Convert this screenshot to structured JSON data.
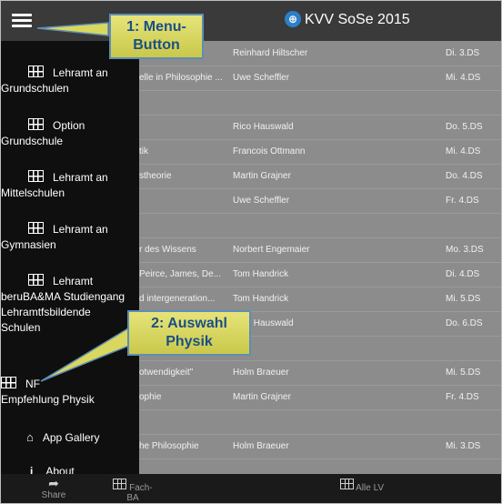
{
  "header": {
    "title": "KVV SoSe 2015"
  },
  "list_rows": [
    {
      "c1": "",
      "c2": "Reinhard Hiltscher",
      "c3": "Di. 3.DS"
    },
    {
      "c1": "elle in Philosophie ...",
      "c2": "Uwe Scheffler",
      "c3": "Mi. 4.DS"
    },
    {
      "c1": "",
      "c2": "",
      "c3": ""
    },
    {
      "c1": "",
      "c2": "Rico Hauswald",
      "c3": "Do. 5.DS"
    },
    {
      "c1": "tik",
      "c2": "Francois Ottmann",
      "c3": "Mi. 4.DS"
    },
    {
      "c1": "stheorie",
      "c2": "Martin Grajner",
      "c3": "Do. 4.DS"
    },
    {
      "c1": "",
      "c2": "Uwe Scheffler",
      "c3": "Fr. 4.DS"
    },
    {
      "c1": "",
      "c2": "",
      "c3": ""
    },
    {
      "c1": "r des Wissens",
      "c2": "Norbert Engemaier",
      "c3": "Mo. 3.DS"
    },
    {
      "c1": "Peirce, James, De...",
      "c2": "Tom Handrick",
      "c3": "Di. 4.DS"
    },
    {
      "c1": "d intergeneration...",
      "c2": "Tom Handrick",
      "c3": "Mi. 5.DS"
    },
    {
      "c1": "",
      "c2": "Rico Hauswald",
      "c3": "Do. 6.DS"
    },
    {
      "c1": "",
      "c2": "",
      "c3": ""
    },
    {
      "c1": "otwendigkeit\"",
      "c2": "Holm Braeuer",
      "c3": "Mi. 5.DS"
    },
    {
      "c1": "ophie",
      "c2": "Martin Grajner",
      "c3": "Fr. 4.DS"
    },
    {
      "c1": "",
      "c2": "",
      "c3": ""
    },
    {
      "c1": "he Philosophie",
      "c2": "Holm Braeuer",
      "c3": "Mi. 3.DS"
    }
  ],
  "drawer": {
    "items": [
      {
        "first": "Lehramt an",
        "rest": "Grundschulen"
      },
      {
        "first": "Option",
        "rest": "Grundschule"
      },
      {
        "first": "Lehramt an",
        "rest": "Mittelschulen"
      },
      {
        "first": "Lehramt an",
        "rest": "Gymnasien"
      },
      {
        "first": "Lehramt",
        "rest": "beruBA&MA Studiengang Lehramtfsbildende Schulen"
      },
      {
        "first": "NF",
        "rest": "Empfehlung Physik"
      }
    ],
    "app_gallery": "App Gallery",
    "about": "About"
  },
  "bottom_nav": {
    "share": "Share",
    "fach_ba": "Fach-BA",
    "alle_lv": "Alle LV"
  },
  "callouts": {
    "menu": "1: Menu-Button",
    "auswahl": "2: Auswahl Physik"
  },
  "colors": {
    "topbar": "#3a3a3a",
    "drawer": "#0f0f0f",
    "callout_fill": "#d9d85e",
    "callout_border": "#5f8db5",
    "callout_text": "#1b4f86"
  }
}
